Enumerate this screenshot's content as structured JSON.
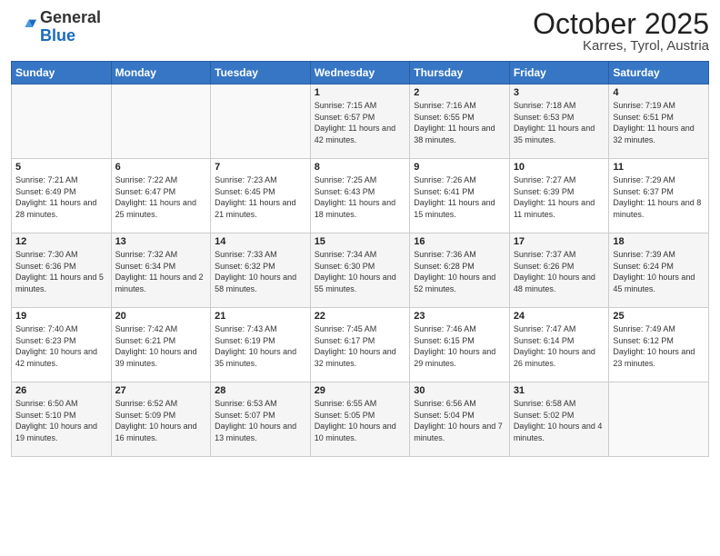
{
  "header": {
    "logo": {
      "general": "General",
      "blue": "Blue"
    },
    "title": "October 2025",
    "subtitle": "Karres, Tyrol, Austria"
  },
  "days_of_week": [
    "Sunday",
    "Monday",
    "Tuesday",
    "Wednesday",
    "Thursday",
    "Friday",
    "Saturday"
  ],
  "weeks": [
    [
      {
        "day": "",
        "info": ""
      },
      {
        "day": "",
        "info": ""
      },
      {
        "day": "",
        "info": ""
      },
      {
        "day": "1",
        "info": "Sunrise: 7:15 AM\nSunset: 6:57 PM\nDaylight: 11 hours and 42 minutes."
      },
      {
        "day": "2",
        "info": "Sunrise: 7:16 AM\nSunset: 6:55 PM\nDaylight: 11 hours and 38 minutes."
      },
      {
        "day": "3",
        "info": "Sunrise: 7:18 AM\nSunset: 6:53 PM\nDaylight: 11 hours and 35 minutes."
      },
      {
        "day": "4",
        "info": "Sunrise: 7:19 AM\nSunset: 6:51 PM\nDaylight: 11 hours and 32 minutes."
      }
    ],
    [
      {
        "day": "5",
        "info": "Sunrise: 7:21 AM\nSunset: 6:49 PM\nDaylight: 11 hours and 28 minutes."
      },
      {
        "day": "6",
        "info": "Sunrise: 7:22 AM\nSunset: 6:47 PM\nDaylight: 11 hours and 25 minutes."
      },
      {
        "day": "7",
        "info": "Sunrise: 7:23 AM\nSunset: 6:45 PM\nDaylight: 11 hours and 21 minutes."
      },
      {
        "day": "8",
        "info": "Sunrise: 7:25 AM\nSunset: 6:43 PM\nDaylight: 11 hours and 18 minutes."
      },
      {
        "day": "9",
        "info": "Sunrise: 7:26 AM\nSunset: 6:41 PM\nDaylight: 11 hours and 15 minutes."
      },
      {
        "day": "10",
        "info": "Sunrise: 7:27 AM\nSunset: 6:39 PM\nDaylight: 11 hours and 11 minutes."
      },
      {
        "day": "11",
        "info": "Sunrise: 7:29 AM\nSunset: 6:37 PM\nDaylight: 11 hours and 8 minutes."
      }
    ],
    [
      {
        "day": "12",
        "info": "Sunrise: 7:30 AM\nSunset: 6:36 PM\nDaylight: 11 hours and 5 minutes."
      },
      {
        "day": "13",
        "info": "Sunrise: 7:32 AM\nSunset: 6:34 PM\nDaylight: 11 hours and 2 minutes."
      },
      {
        "day": "14",
        "info": "Sunrise: 7:33 AM\nSunset: 6:32 PM\nDaylight: 10 hours and 58 minutes."
      },
      {
        "day": "15",
        "info": "Sunrise: 7:34 AM\nSunset: 6:30 PM\nDaylight: 10 hours and 55 minutes."
      },
      {
        "day": "16",
        "info": "Sunrise: 7:36 AM\nSunset: 6:28 PM\nDaylight: 10 hours and 52 minutes."
      },
      {
        "day": "17",
        "info": "Sunrise: 7:37 AM\nSunset: 6:26 PM\nDaylight: 10 hours and 48 minutes."
      },
      {
        "day": "18",
        "info": "Sunrise: 7:39 AM\nSunset: 6:24 PM\nDaylight: 10 hours and 45 minutes."
      }
    ],
    [
      {
        "day": "19",
        "info": "Sunrise: 7:40 AM\nSunset: 6:23 PM\nDaylight: 10 hours and 42 minutes."
      },
      {
        "day": "20",
        "info": "Sunrise: 7:42 AM\nSunset: 6:21 PM\nDaylight: 10 hours and 39 minutes."
      },
      {
        "day": "21",
        "info": "Sunrise: 7:43 AM\nSunset: 6:19 PM\nDaylight: 10 hours and 35 minutes."
      },
      {
        "day": "22",
        "info": "Sunrise: 7:45 AM\nSunset: 6:17 PM\nDaylight: 10 hours and 32 minutes."
      },
      {
        "day": "23",
        "info": "Sunrise: 7:46 AM\nSunset: 6:15 PM\nDaylight: 10 hours and 29 minutes."
      },
      {
        "day": "24",
        "info": "Sunrise: 7:47 AM\nSunset: 6:14 PM\nDaylight: 10 hours and 26 minutes."
      },
      {
        "day": "25",
        "info": "Sunrise: 7:49 AM\nSunset: 6:12 PM\nDaylight: 10 hours and 23 minutes."
      }
    ],
    [
      {
        "day": "26",
        "info": "Sunrise: 6:50 AM\nSunset: 5:10 PM\nDaylight: 10 hours and 19 minutes."
      },
      {
        "day": "27",
        "info": "Sunrise: 6:52 AM\nSunset: 5:09 PM\nDaylight: 10 hours and 16 minutes."
      },
      {
        "day": "28",
        "info": "Sunrise: 6:53 AM\nSunset: 5:07 PM\nDaylight: 10 hours and 13 minutes."
      },
      {
        "day": "29",
        "info": "Sunrise: 6:55 AM\nSunset: 5:05 PM\nDaylight: 10 hours and 10 minutes."
      },
      {
        "day": "30",
        "info": "Sunrise: 6:56 AM\nSunset: 5:04 PM\nDaylight: 10 hours and 7 minutes."
      },
      {
        "day": "31",
        "info": "Sunrise: 6:58 AM\nSunset: 5:02 PM\nDaylight: 10 hours and 4 minutes."
      },
      {
        "day": "",
        "info": ""
      }
    ]
  ]
}
